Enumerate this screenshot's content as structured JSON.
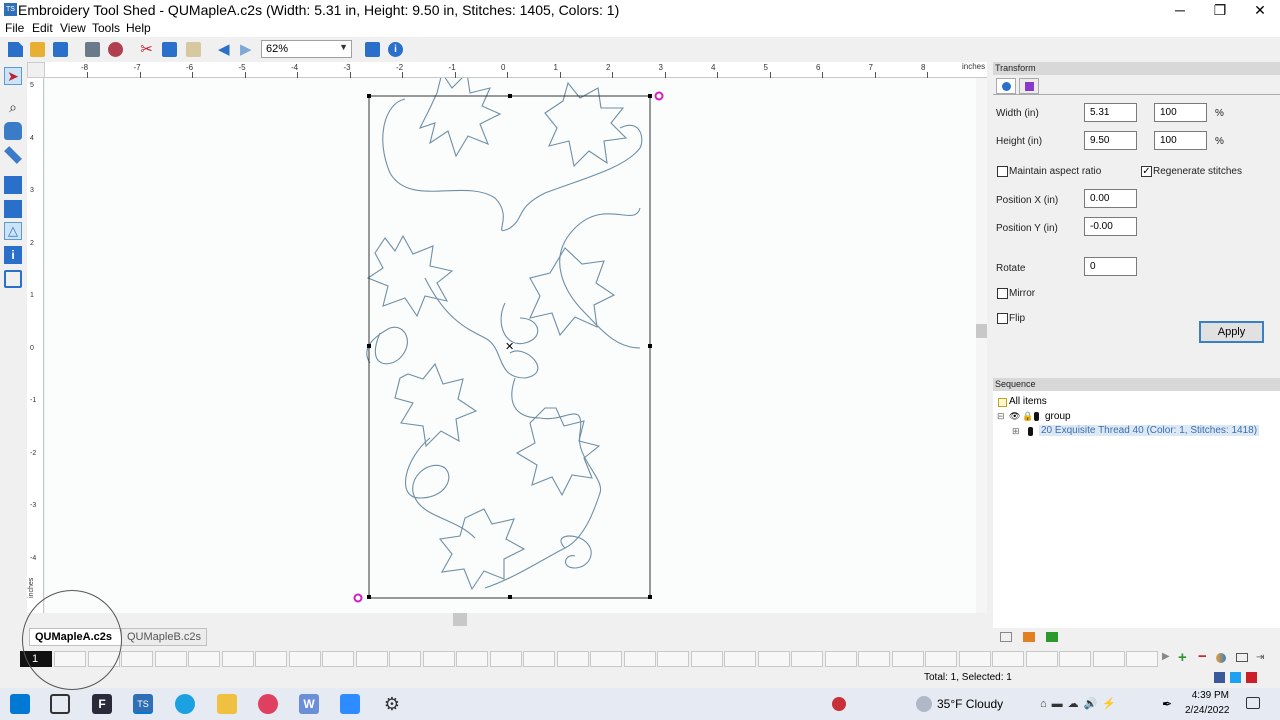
{
  "window": {
    "title": "Embroidery Tool Shed - QUMapleA.c2s (Width: 5.31 in, Height: 9.50 in, Stitches: 1405, Colors: 1)",
    "minimize": "─",
    "maximize": "❐",
    "close": "✕"
  },
  "menu": [
    "File",
    "Edit",
    "View",
    "Tools",
    "Help"
  ],
  "toolbar": {
    "zoom": "62%"
  },
  "ruler": {
    "h_ticks": [
      "-8",
      "-7",
      "-6",
      "-5",
      "-4",
      "-3",
      "-2",
      "-1",
      "0",
      "1",
      "2",
      "3",
      "4",
      "5",
      "6",
      "7",
      "8"
    ],
    "unit": "inches",
    "v_ticks": [
      "5",
      "4",
      "3",
      "2",
      "1",
      "0",
      "-1",
      "-2",
      "-3",
      "-4"
    ],
    "v_unit": "inches"
  },
  "tabs": [
    {
      "label": "QUMapleA.c2s",
      "close": "✕"
    },
    {
      "label": "QUMapleB.c2s"
    }
  ],
  "stitch": {
    "current": "1"
  },
  "status": "Total: 1, Selected: 1",
  "transform": {
    "title": "Transform",
    "width_label": "Width (in)",
    "width_value": "5.31",
    "width_pct": "100",
    "height_label": "Height (in)",
    "height_value": "9.50",
    "height_pct": "100",
    "pct_sign": "%",
    "maintain_label": "Maintain aspect ratio",
    "maintain_checked": false,
    "regenerate_label": "Regenerate stitches",
    "regenerate_checked": true,
    "posx_label": "Position X (in)",
    "posx_value": "0.00",
    "posy_label": "Position Y (in)",
    "posy_value": "-0.00",
    "rotate_label": "Rotate",
    "rotate_value": "0",
    "mirror_label": "Mirror",
    "flip_label": "Flip",
    "apply_label": "Apply"
  },
  "sequence": {
    "title": "Sequence",
    "all_items": "All items",
    "group": "group",
    "thread": "20 Exquisite Thread 40 (Color: 1, Stitches: 1418)"
  },
  "taskbar": {
    "weather": "35°F  Cloudy",
    "time": "4:39 PM",
    "date": "2/24/2022"
  },
  "colors": {
    "accent": "#3c7fc1",
    "stitch": "#6f8fa5",
    "handle": "#d020c0"
  }
}
